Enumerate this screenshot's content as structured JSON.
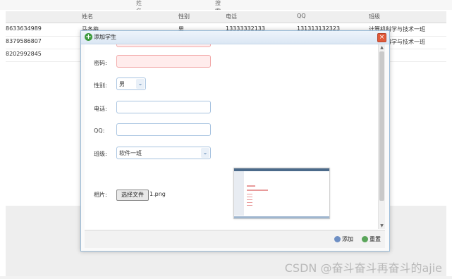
{
  "toolbar": {
    "search_placeholder": "姓名",
    "search_label": "搜索"
  },
  "grid": {
    "columns": [
      "姓名",
      "性别",
      "电话",
      "QQ",
      "班级"
    ],
    "rows": [
      {
        "id": "8633634989",
        "name": "马冬梅",
        "sex": "男",
        "phone": "13333332133",
        "qq": "131313132323",
        "class": "计算机科学与技术一班"
      },
      {
        "id": "8379586807",
        "name": "",
        "sex": "",
        "phone": "",
        "qq": "",
        "class": "计算机科学与技术一班"
      },
      {
        "id": "8202992845",
        "name": "",
        "sex": "",
        "phone": "",
        "qq": "",
        "class": ""
      }
    ]
  },
  "dialog": {
    "title": "添加学生",
    "fields": {
      "password_label": "密码:",
      "gender_label": "性别:",
      "gender_value": "男",
      "phone_label": "电话:",
      "qq_label": "QQ:",
      "class_label": "班级:",
      "class_value": "软件一班",
      "photo_label": "相片:",
      "file_button": "选择文件",
      "file_name": "1.png"
    },
    "buttons": {
      "add": "添加",
      "reset": "重置"
    }
  },
  "watermark": "CSDN @奋斗奋斗再奋斗的ajie",
  "colors": {
    "dialog_border": "#9bbcd8",
    "invalid_field_bg": "#ffecec",
    "close_button": "#e05a3a",
    "add_icon": "#3c9a3c"
  }
}
